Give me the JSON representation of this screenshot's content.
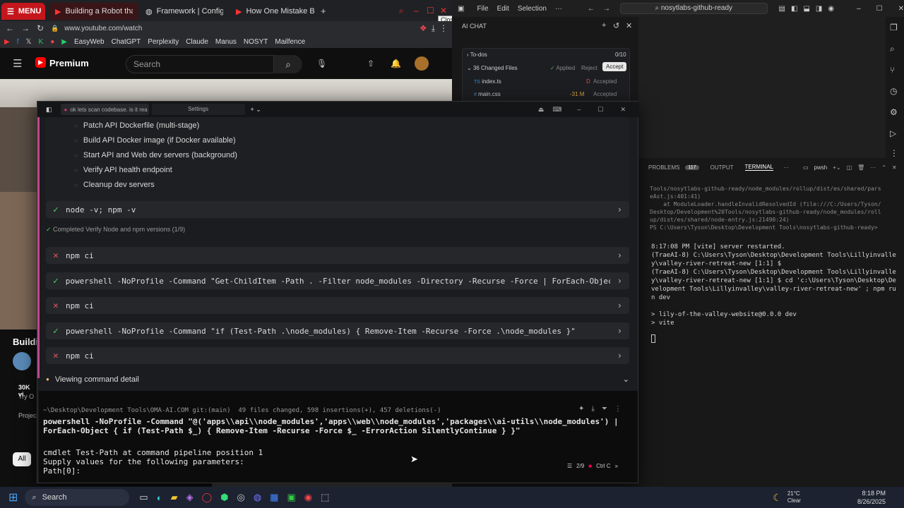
{
  "browser": {
    "tabs": [
      {
        "label": "MENU"
      },
      {
        "label": "Building a Robot that"
      },
      {
        "label": "Framework | Configure F"
      },
      {
        "label": "How One Mistake Broke C"
      }
    ],
    "close_tooltip": "Close",
    "url": "www.youtube.com/watch",
    "bookmarks": [
      "EasyWeb",
      "ChatGPT",
      "Perplexity",
      "Claude",
      "Manus",
      "NOSYT",
      "Mailfence"
    ],
    "youtube": {
      "logo": "Premium",
      "search_placeholder": "Search"
    },
    "side": {
      "title": "Buildi",
      "views": "30K vi",
      "try": "Try O",
      "proj": "Projec",
      "chip": "All",
      "thumb": "How Your Brain Works"
    }
  },
  "trae": {
    "tabs": [
      {
        "label": "ok lets scan codebase. is it rea"
      },
      {
        "label": "Settings"
      }
    ],
    "todos": [
      "Patch API Dockerfile (multi-stage)",
      "Build API Docker image (if Docker available)",
      "Start API and Web dev servers (background)",
      "Verify API health endpoint",
      "Cleanup dev servers"
    ],
    "commands": [
      {
        "status": "ok",
        "text": "node -v; npm -v"
      },
      {
        "status": "fail",
        "text": "npm ci"
      },
      {
        "status": "ok",
        "text": "powershell -NoProfile -Command \"Get-ChildItem -Path . -Filter node_modules -Directory -Recurse -Force | ForEach-Object"
      },
      {
        "status": "fail",
        "text": "npm ci"
      },
      {
        "status": "ok",
        "text": "powershell -NoProfile -Command \"if (Test-Path .\\node_modules) { Remove-Item -Recurse -Force .\\node_modules }\""
      },
      {
        "status": "fail",
        "text": "npm ci"
      }
    ],
    "completed_note": "Completed Verify Node and npm versions (1/9)",
    "viewing": "Viewing command detail",
    "terminal": {
      "header": "~\\Desktop\\Development Tools\\OMA-AI.COM git:(main)  49 files changed, 598 insertions(+), 457 deletions(-)",
      "line1": "powershell -NoProfile -Command \"@('apps\\\\api\\\\node_modules','apps\\\\web\\\\node_modules','packages\\\\ai-utils\\\\node_modules') |",
      "line2": "ForEach-Object { if (Test-Path $_) { Remove-Item -Recurse -Force $_ -ErrorAction SilentlyContinue } }\"",
      "line3": "cmdlet Test-Path at command pipeline position 1",
      "line4": "Supply values for the following parameters:",
      "line5": "Path[0]:",
      "counter": "2/9",
      "ctrl": "Ctrl C"
    }
  },
  "vscode": {
    "menu": [
      "File",
      "Edit",
      "Selection"
    ],
    "search": "nosytlabs-github-ready",
    "ai_chat": "AI CHAT",
    "todos": "To-dos",
    "todos_count": "0/10",
    "changed": "36 Changed Files",
    "applied": "Applied",
    "reject": "Reject",
    "accept": "Accept",
    "files": [
      {
        "badge": "TS",
        "name": "index.ts",
        "code": "D",
        "status": "Accepted"
      },
      {
        "badge": "#",
        "name": "main.css",
        "code": "-31 M",
        "status": "Accepted"
      }
    ],
    "panel_tabs": [
      "PROBLEMS",
      "OUTPUT",
      "TERMINAL"
    ],
    "problems_count": "117",
    "shell": "pwsh",
    "panel_text": "Tools/nosytlabs-github-ready/node_modules/rollup/dist/es/shared/pars\neAst.js:401:41)\n    at ModuleLoader.handleInvalidResolvedId (file:///C:/Users/Tyson/\nDesktop/Development%20Tools/nosytlabs-github-ready/node_modules/roll\nup/dist/es/shared/node-entry.js:21490:24)\nPS C:\\Users\\Tyson\\Desktop\\Development Tools\\nosytlabs-github-ready> ",
    "term2_text": "8:17:08 PM [vite] server restarted.\n(TraeAI-8) C:\\Users\\Tyson\\Desktop\\Development Tools\\Lillyinvalle\ny\\valley-river-retreat-new [1:1] $\n(TraeAI-8) C:\\Users\\Tyson\\Desktop\\Development Tools\\Lillyinvalle\ny\\valley-river-retreat-new [1:1] $ cd 'c:\\Users\\Tyson\\Desktop\\De\nvelopment Tools\\Lillyinvalley\\valley-river-retreat-new' ; npm ru\nn dev\n\n> lily-of-the-valley-website@0.0.0 dev\n> vite"
  },
  "taskbar": {
    "search": "Search",
    "temp": "21°C",
    "weather": "Clear",
    "time": "8:18 PM",
    "date": "8/26/2025"
  }
}
